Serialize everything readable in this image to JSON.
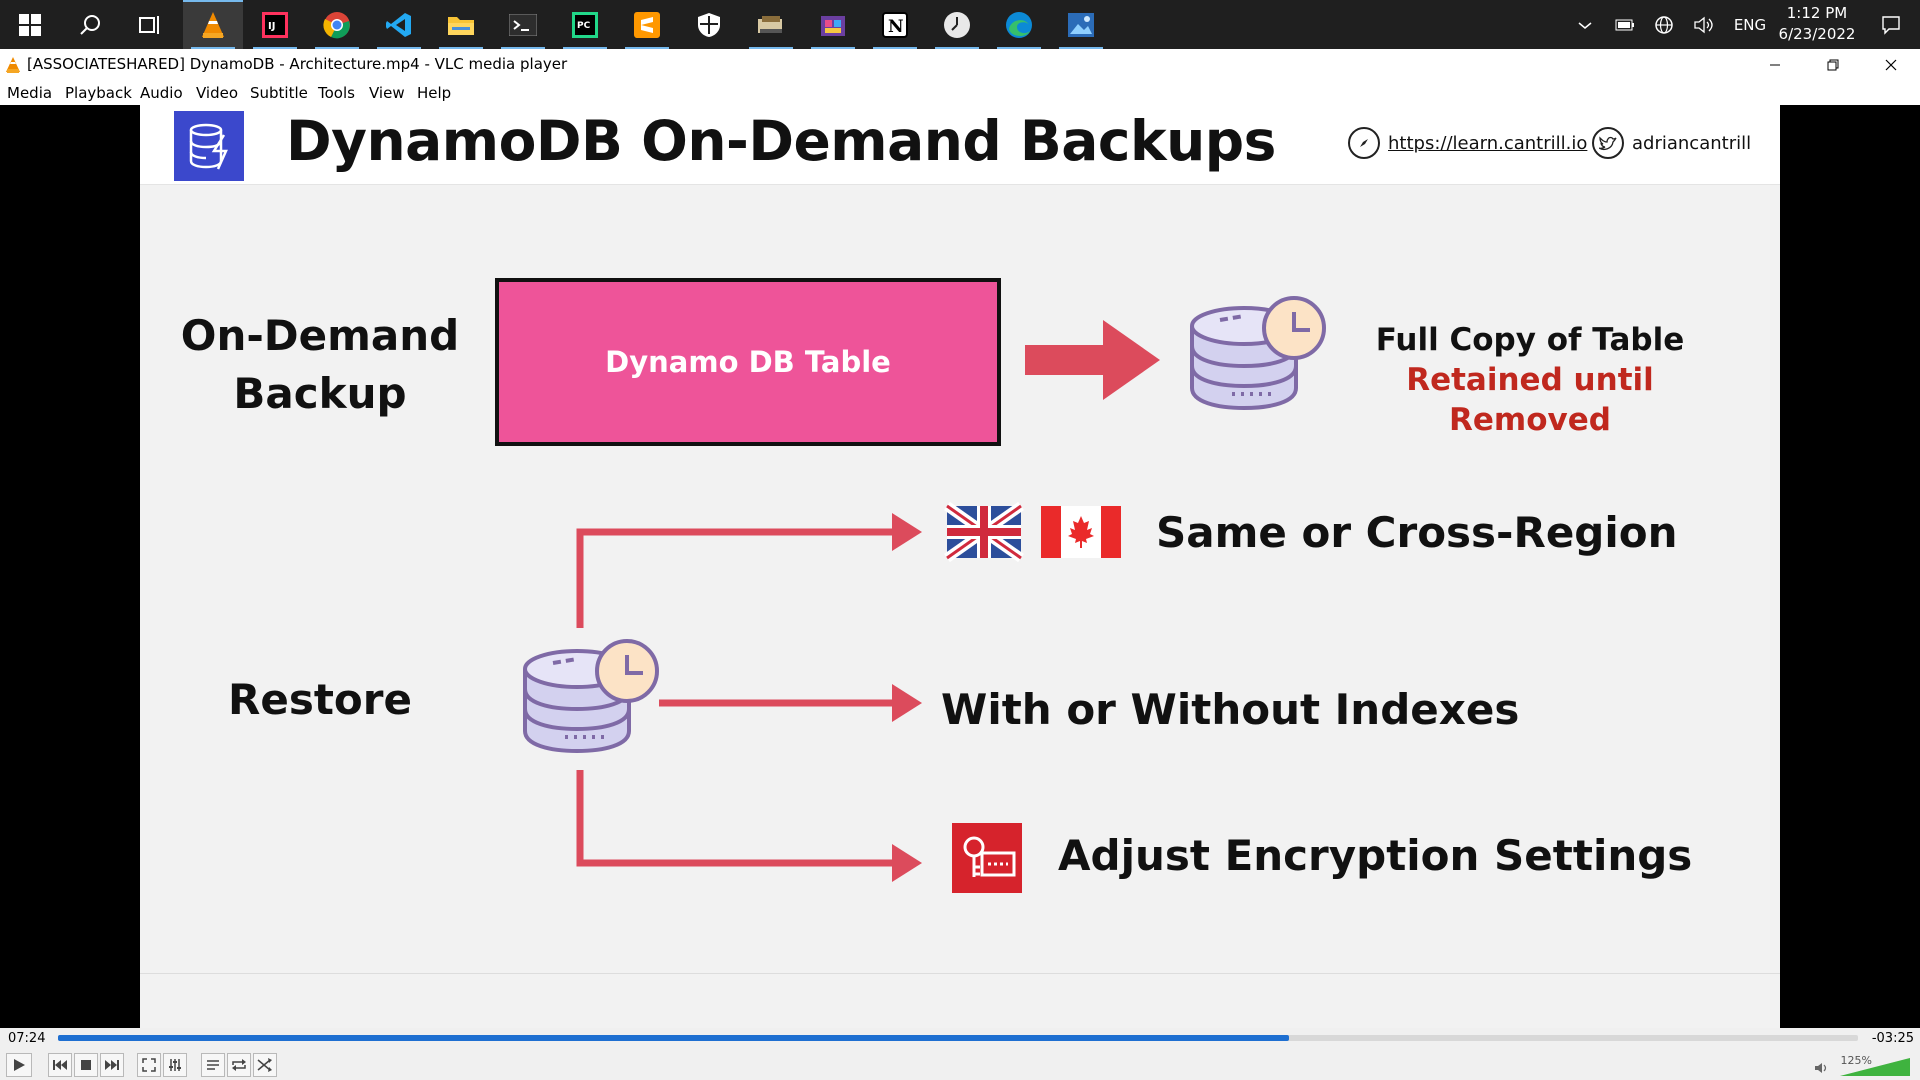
{
  "taskbar": {
    "apps": [
      {
        "name": "vlc",
        "icon": "vlc-icon"
      },
      {
        "name": "intellij",
        "icon": "intellij-icon"
      },
      {
        "name": "chrome",
        "icon": "chrome-icon"
      },
      {
        "name": "vscode",
        "icon": "vscode-icon"
      },
      {
        "name": "file-explorer",
        "icon": "folder-icon"
      },
      {
        "name": "terminal",
        "icon": "terminal-icon"
      },
      {
        "name": "pycharm",
        "icon": "pycharm-icon"
      },
      {
        "name": "sublime",
        "icon": "sublime-icon"
      },
      {
        "name": "security",
        "icon": "shield-icon"
      },
      {
        "name": "app-1",
        "icon": "app-icon"
      },
      {
        "name": "app-2",
        "icon": "app-icon"
      },
      {
        "name": "notion",
        "icon": "notion-icon"
      },
      {
        "name": "clock-app",
        "icon": "clock-icon"
      },
      {
        "name": "edge",
        "icon": "edge-icon"
      },
      {
        "name": "photos",
        "icon": "photos-icon"
      }
    ],
    "tray": {
      "lang": "ENG",
      "time": "1:12 PM",
      "date": "6/23/2022"
    }
  },
  "window": {
    "title": "[ASSOCIATESHARED] DynamoDB - Architecture.mp4 - VLC media player"
  },
  "menu": [
    "Media",
    "Playback",
    "Audio",
    "Video",
    "Subtitle",
    "Tools",
    "View",
    "Help"
  ],
  "slide": {
    "title": "DynamoDB On-Demand Backups",
    "link": "https://learn.cantrill.io",
    "twitter": "adriancantrill",
    "ondemand_label_1": "On-Demand",
    "ondemand_label_2": "Backup",
    "table_label": "Dynamo DB Table",
    "full_copy": "Full Copy of Table",
    "retained": "Retained until Removed",
    "restore_label": "Restore",
    "feature_region": "Same or Cross-Region",
    "feature_indexes": "With or Without Indexes",
    "feature_encryption": "Adjust Encryption Settings",
    "colors": {
      "table_fill": "#ee5499",
      "arrow": "#dc4b5c",
      "retained_text": "#c0281e",
      "db_fill": "#d3d1ef",
      "db_stroke": "#7f6aa6",
      "kms_red": "#d6232c"
    }
  },
  "player": {
    "elapsed": "07:24",
    "remaining": "-03:25",
    "progress": 0.684,
    "volume": "125%",
    "volume_level": 1.0
  }
}
